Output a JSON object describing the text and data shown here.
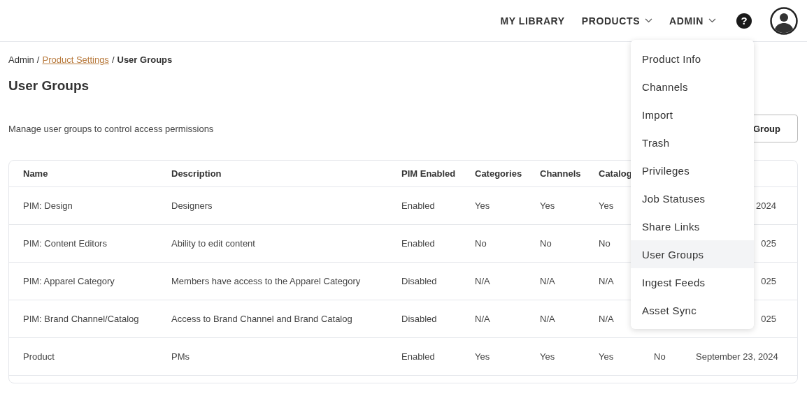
{
  "nav": {
    "links": [
      {
        "label": "MY LIBRARY",
        "dropdown": false
      },
      {
        "label": "PRODUCTS",
        "dropdown": true
      },
      {
        "label": "ADMIN",
        "dropdown": true
      }
    ],
    "help": "?"
  },
  "breadcrumb": [
    {
      "label": "Admin",
      "kind": "text"
    },
    {
      "label": "/",
      "kind": "separator"
    },
    {
      "label": "Product Settings",
      "kind": "link"
    },
    {
      "label": "/",
      "kind": "separator"
    },
    {
      "label": "User Groups",
      "kind": "current"
    }
  ],
  "page": {
    "title": "User Groups",
    "description": "Manage user groups to control access permissions",
    "button": "Group"
  },
  "table": {
    "columns": [
      "Name",
      "Description",
      "PIM Enabled",
      "Categories",
      "Channels",
      "Catalog"
    ],
    "rows": [
      {
        "name": "PIM: Design",
        "description": "Designers",
        "pim_enabled": "Enabled",
        "categories": "Yes",
        "channels": "Yes",
        "catalog": "Yes",
        "column_8": "2024"
      },
      {
        "name": "PIM: Content Editors",
        "description": "Ability to edit content",
        "pim_enabled": "Enabled",
        "categories": "No",
        "channels": "No",
        "catalog": "No",
        "column_8": "025"
      },
      {
        "name": "PIM: Apparel Category",
        "description": "Members have access to the Apparel Category",
        "pim_enabled": "Disabled",
        "categories": "N/A",
        "channels": "N/A",
        "catalog": "N/A",
        "column_8": "025"
      },
      {
        "name": "PIM: Brand Channel/Catalog",
        "description": "Access to Brand Channel and Brand Catalog",
        "pim_enabled": "Disabled",
        "categories": "N/A",
        "channels": "N/A",
        "catalog": "N/A",
        "column_8": "025"
      },
      {
        "name": "Product",
        "description": "PMs",
        "pim_enabled": "Enabled",
        "categories": "Yes",
        "channels": "Yes",
        "catalog": "Yes",
        "column_7": "No",
        "column_8": "September 23, 2024"
      }
    ]
  },
  "admin_menu": {
    "items": [
      {
        "label": "Product Info",
        "selected": false
      },
      {
        "label": "Channels",
        "selected": false
      },
      {
        "label": "Import",
        "selected": false
      },
      {
        "label": "Trash",
        "selected": false
      },
      {
        "label": "Privileges",
        "selected": false
      },
      {
        "label": "Job Statuses",
        "selected": false
      },
      {
        "label": "Share Links",
        "selected": false
      },
      {
        "label": "User Groups",
        "selected": true
      },
      {
        "label": "Ingest Feeds",
        "selected": false
      },
      {
        "label": "Asset Sync",
        "selected": false
      }
    ]
  }
}
